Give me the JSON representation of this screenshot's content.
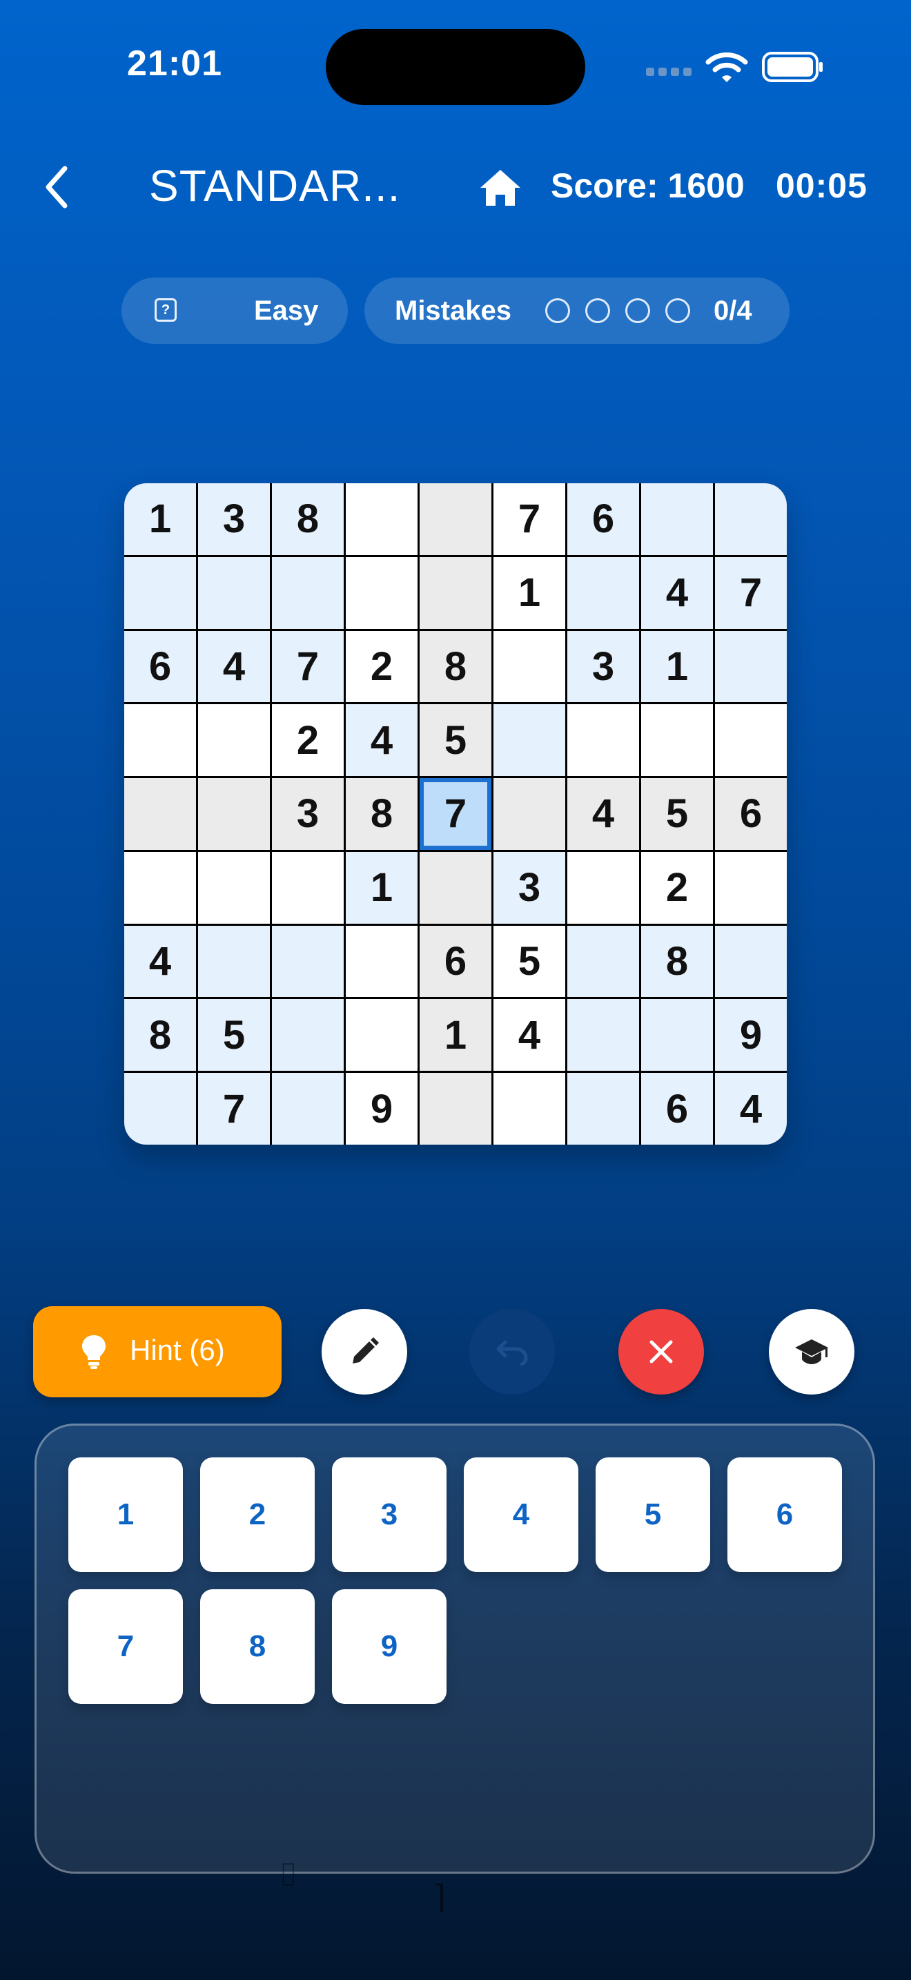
{
  "status_bar": {
    "time": "21:01"
  },
  "header": {
    "title": "STANDAR...",
    "score": "Score: 1600",
    "timer": "00:05"
  },
  "info": {
    "difficulty": "Easy",
    "mistakes_label": "Mistakes",
    "mistakes_count": "0/4",
    "mistakes_used": 0,
    "mistakes_max": 4
  },
  "board": {
    "selected": [
      4,
      4
    ],
    "rows": [
      [
        "1",
        "3",
        "8",
        "",
        "",
        "7",
        "6",
        "",
        ""
      ],
      [
        "",
        "",
        "",
        "",
        "",
        "1",
        "",
        "4",
        "7"
      ],
      [
        "6",
        "4",
        "7",
        "2",
        "8",
        "",
        "3",
        "1",
        ""
      ],
      [
        "",
        "",
        "2",
        "4",
        "5",
        "",
        "",
        "",
        ""
      ],
      [
        "",
        "",
        "3",
        "8",
        "7",
        "",
        "4",
        "5",
        "6"
      ],
      [
        "",
        "",
        "",
        "1",
        "",
        "3",
        "",
        "2",
        ""
      ],
      [
        "4",
        "",
        "",
        "",
        "6",
        "5",
        "",
        "8",
        ""
      ],
      [
        "8",
        "5",
        "",
        "",
        "1",
        "4",
        "",
        "",
        "9"
      ],
      [
        "",
        "7",
        "",
        "9",
        "",
        "",
        "",
        "6",
        "4"
      ]
    ]
  },
  "tools": {
    "hint_label": "Hint (6)"
  },
  "keypad": {
    "keys": [
      "1",
      "2",
      "3",
      "4",
      "5",
      "6",
      "7",
      "8",
      "9"
    ]
  },
  "colors": {
    "hint": "#ff9a00",
    "erase": "#f04040",
    "selected_border": "#1d6fd0",
    "key_text": "#0e64c4"
  }
}
